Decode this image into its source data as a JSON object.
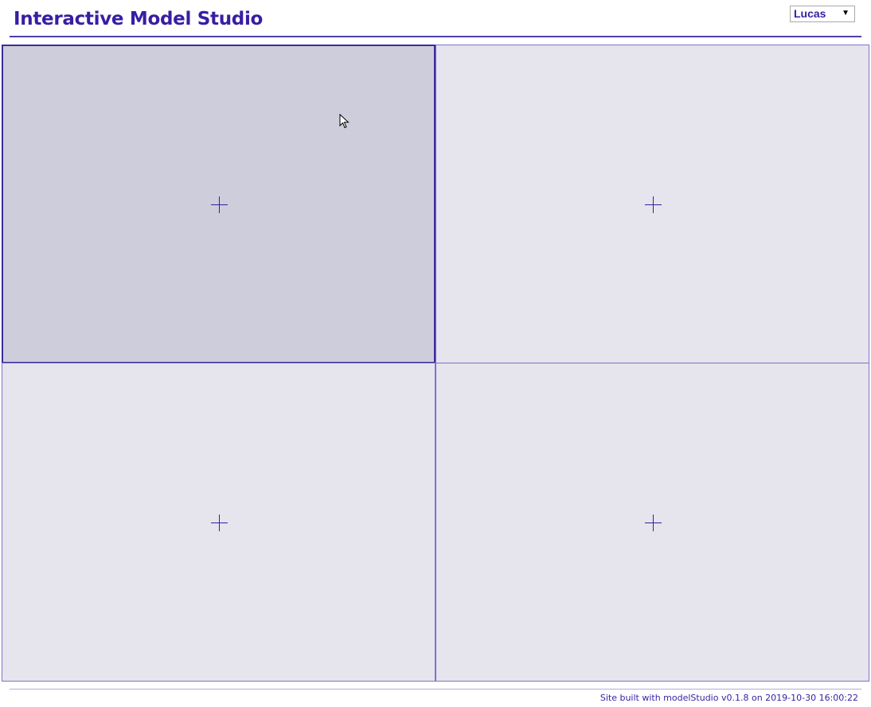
{
  "header": {
    "title": "Interactive Model Studio",
    "user_select": {
      "selected": "Lucas",
      "arrow": "▼"
    }
  },
  "grid": {
    "cells": [
      {
        "icon": "plus-icon",
        "state": "hovered"
      },
      {
        "icon": "plus-icon",
        "state": "default"
      },
      {
        "icon": "plus-icon",
        "state": "default"
      },
      {
        "icon": "plus-icon",
        "state": "default"
      }
    ]
  },
  "footer": {
    "text": "Site built with modelStudio v0.1.8 on 2019-10-30 16:00:22"
  },
  "colors": {
    "accent": "#371ea3",
    "cell_background": "#e6e4ed",
    "cell_hover_background": "#cecddb",
    "border": "#4b3fa9"
  }
}
